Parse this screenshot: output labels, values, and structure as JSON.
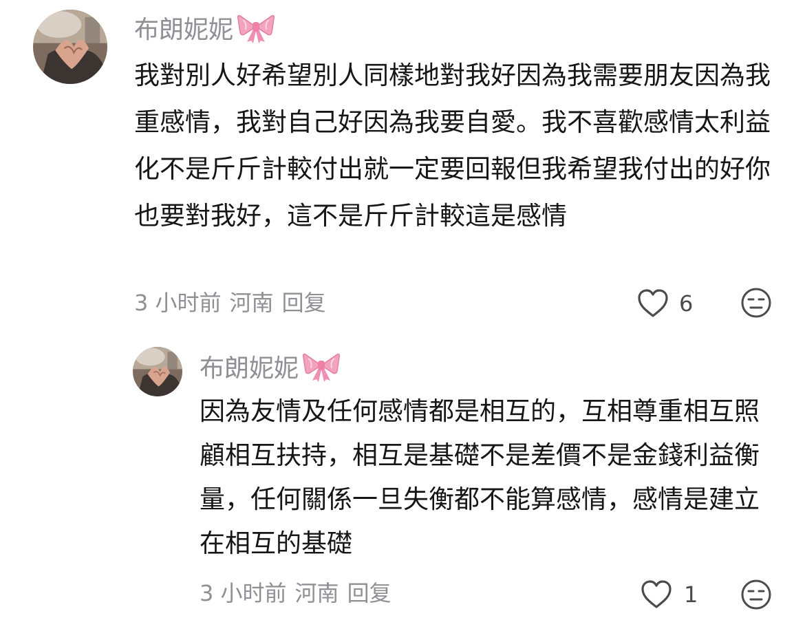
{
  "comments": [
    {
      "username": "布朗妮妮",
      "username_emoji": "ribbon-bow-icon",
      "text": "我對別人好希望別人同樣地對我好因為我需要朋友因為我重感情，我對自己好因為我要自愛。我不喜歡感情太利益化不是斤斤計較付出就一定要回報但我希望我付出的好你也要對我好，這不是斤斤計較這是感情",
      "time": "3 小时前",
      "location": "河南",
      "reply_label": "回复",
      "likes": "6"
    },
    {
      "username": "布朗妮妮",
      "username_emoji": "ribbon-bow-icon",
      "text": "因為友情及任何感情都是相互的，互相尊重相互照顧相互扶持，相互是基礎不是差價不是金錢利益衡量，任何關係一旦失衡都不能算感情，感情是建立在相互的基礎",
      "time": "3 小时前",
      "location": "河南",
      "reply_label": "回复",
      "likes": "1"
    }
  ],
  "colors": {
    "text": "#161616",
    "meta": "#8f8f95",
    "bow": "#f29bb7"
  }
}
